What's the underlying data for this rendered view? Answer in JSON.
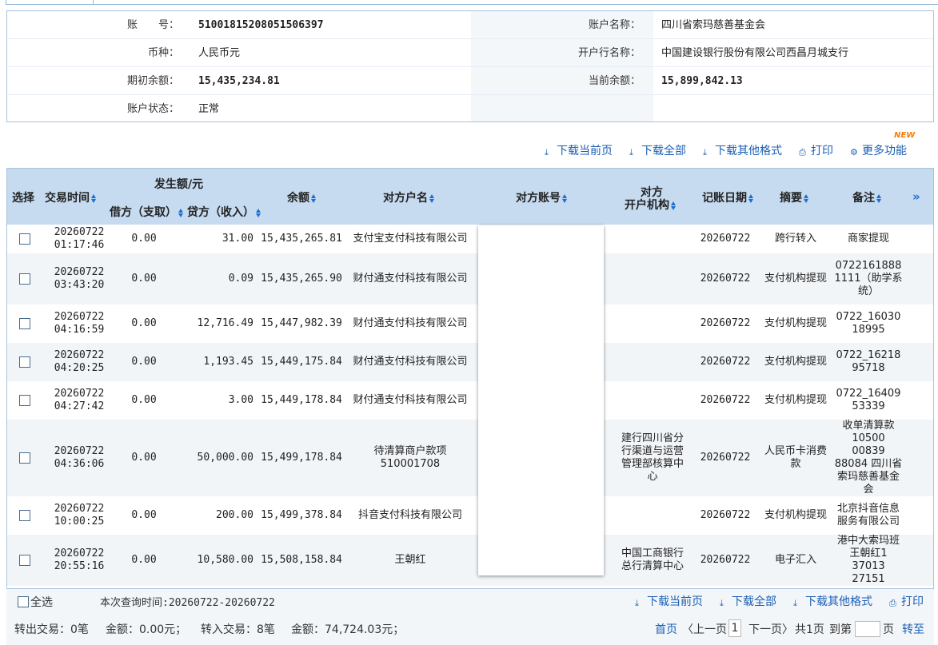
{
  "account": {
    "no_label": "账　　号：",
    "no_value": "51001815208051506397",
    "name_label": "账户名称：",
    "name_value": "四川省索玛慈善基金会",
    "currency_label": "币种：",
    "currency_value": "人民币元",
    "bank_label": "开户行名称：",
    "bank_value": "中国建设银行股份有限公司西昌月城支行",
    "opening_label": "期初余额：",
    "opening_value": "15,435,234.81",
    "current_label": "当前余额：",
    "current_value": "15,899,842.13",
    "status_label": "账户状态：",
    "status_value": "正常"
  },
  "toolbar": {
    "new_badge": "NEW",
    "download_page": "下载当前页",
    "download_all": "下载全部",
    "download_other": "下载其他格式",
    "print": "打印",
    "more": "更多功能"
  },
  "table": {
    "headers": {
      "select": "选择",
      "time": "交易时间",
      "amount_group": "发生额/元",
      "debit": "借方（支取）",
      "credit": "贷方（收入）",
      "balance": "余额",
      "counterparty_name": "对方户名",
      "counterparty_account": "对方账号",
      "counterparty_bank_1": "对方",
      "counterparty_bank_2": "开户机构",
      "booking_date": "记账日期",
      "summary": "摘要",
      "remark": "备注",
      "more": "»"
    },
    "rows": [
      {
        "date": "20260722",
        "time": "01:17:46",
        "debit": "0.00",
        "credit": "31.00",
        "balance": "15,435,265.81",
        "name": "支付宝支付科技有限公司",
        "bank": "",
        "book": "20260722",
        "summary": "跨行转入",
        "remark": "商家提现"
      },
      {
        "date": "20260722",
        "time": "03:43:20",
        "debit": "0.00",
        "credit": "0.09",
        "balance": "15,435,265.90",
        "name": "财付通支付科技有限公司",
        "bank": "",
        "book": "20260722",
        "summary": "支付机构提现",
        "remark": "0722161888 1111（助学系统）"
      },
      {
        "date": "20260722",
        "time": "04:16:59",
        "debit": "0.00",
        "credit": "12,716.49",
        "balance": "15,447,982.39",
        "name": "财付通支付科技有限公司",
        "bank": "",
        "book": "20260722",
        "summary": "支付机构提现",
        "remark": "0722_16030 18995"
      },
      {
        "date": "20260722",
        "time": "04:20:25",
        "debit": "0.00",
        "credit": "1,193.45",
        "balance": "15,449,175.84",
        "name": "财付通支付科技有限公司",
        "bank": "",
        "book": "20260722",
        "summary": "支付机构提现",
        "remark": "0722_16218 95718"
      },
      {
        "date": "20260722",
        "time": "04:27:42",
        "debit": "0.00",
        "credit": "3.00",
        "balance": "15,449,178.84",
        "name": "财付通支付科技有限公司",
        "bank": "",
        "book": "20260722",
        "summary": "支付机构提现",
        "remark": "0722_16409 53339"
      },
      {
        "date": "20260722",
        "time": "04:36:06",
        "debit": "0.00",
        "credit": "50,000.00",
        "balance": "15,499,178.84",
        "name": "待清算商户款项510001708",
        "bank": "建行四川省分行渠道与运营管理部核算中心",
        "book": "20260722",
        "summary": "人民币卡消费款",
        "remark": "收单清算款10500 00839 88084 四川省索玛慈善基金会"
      },
      {
        "date": "20260722",
        "time": "10:00:25",
        "debit": "0.00",
        "credit": "200.00",
        "balance": "15,499,378.84",
        "name": "抖音支付科技有限公司",
        "bank": "",
        "book": "20260722",
        "summary": "支付机构提现",
        "remark": "北京抖音信息服务有限公司"
      },
      {
        "date": "20260722",
        "time": "20:55:16",
        "debit": "0.00",
        "credit": "10,580.00",
        "balance": "15,508,158.84",
        "name": "王朝红",
        "bank": "中国工商银行总行清算中心",
        "book": "20260722",
        "summary": "电子汇入",
        "remark": "港中大索玛班王朝红1 37013 27151"
      }
    ]
  },
  "footer": {
    "select_all": "全选",
    "query_time": "本次查询时间:20260722-20260722",
    "download_page": "下载当前页",
    "download_all": "下载全部",
    "download_other": "下载其他格式",
    "print": "打印",
    "out_label": "转出交易：0笔",
    "out_amount": "金额：0.00元；",
    "in_label": "转入交易：8笔",
    "in_amount": "金额：74,724.03元；",
    "first": "首页",
    "prev": "〈上一页",
    "current_page": "1",
    "next": "下一页〉",
    "total_pages": "共1页",
    "goto_label": "到第",
    "page_unit": "页",
    "go": "转至"
  },
  "icons": {
    "download": "download-icon",
    "print": "print-icon",
    "more": "gear-icon"
  },
  "colors": {
    "link": "#1a5fb4",
    "header_bg": "#c6dbf0",
    "border": "#a7c3dd",
    "new_badge": "#ff7a00"
  }
}
